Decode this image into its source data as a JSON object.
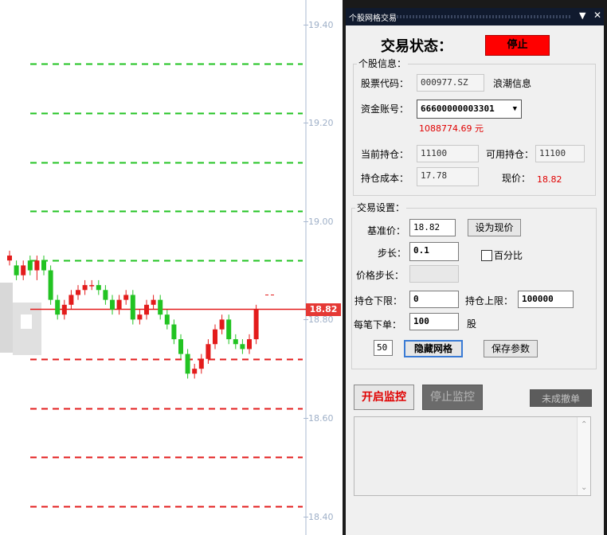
{
  "chart": {
    "price_axis_ticks": [
      "19.40",
      "19.20",
      "19.00",
      "18.80",
      "18.60",
      "18.40"
    ],
    "current_price_tag": "18.82",
    "colors": {
      "up": "#e31c1c",
      "down": "#22c322",
      "grid_up": "#22c322",
      "grid_down": "#e31c1c",
      "price_line": "#e31c1c",
      "axis": "#a8b8d0"
    },
    "grid_lines_above": [
      19.32,
      19.22,
      19.12,
      19.02,
      18.92
    ],
    "grid_lines_below": [
      18.72,
      18.62,
      18.52,
      18.42
    ],
    "candles": [
      {
        "o": 18.92,
        "c": 18.93,
        "h": 18.94,
        "l": 18.91
      },
      {
        "o": 18.91,
        "c": 18.89,
        "h": 18.92,
        "l": 18.88
      },
      {
        "o": 18.89,
        "c": 18.91,
        "h": 18.92,
        "l": 18.88
      },
      {
        "o": 18.92,
        "c": 18.9,
        "h": 18.93,
        "l": 18.89
      },
      {
        "o": 18.9,
        "c": 18.92,
        "h": 18.93,
        "l": 18.88
      },
      {
        "o": 18.92,
        "c": 18.9,
        "h": 18.93,
        "l": 18.89
      },
      {
        "o": 18.9,
        "c": 18.84,
        "h": 18.91,
        "l": 18.83
      },
      {
        "o": 18.84,
        "c": 18.81,
        "h": 18.85,
        "l": 18.8
      },
      {
        "o": 18.81,
        "c": 18.83,
        "h": 18.84,
        "l": 18.8
      },
      {
        "o": 18.83,
        "c": 18.85,
        "h": 18.86,
        "l": 18.82
      },
      {
        "o": 18.85,
        "c": 18.86,
        "h": 18.87,
        "l": 18.84
      },
      {
        "o": 18.86,
        "c": 18.87,
        "h": 18.88,
        "l": 18.85
      },
      {
        "o": 18.87,
        "c": 18.87,
        "h": 18.88,
        "l": 18.86
      },
      {
        "o": 18.87,
        "c": 18.86,
        "h": 18.88,
        "l": 18.85
      },
      {
        "o": 18.86,
        "c": 18.84,
        "h": 18.87,
        "l": 18.83
      },
      {
        "o": 18.84,
        "c": 18.82,
        "h": 18.85,
        "l": 18.81
      },
      {
        "o": 18.82,
        "c": 18.84,
        "h": 18.85,
        "l": 18.81
      },
      {
        "o": 18.84,
        "c": 18.85,
        "h": 18.86,
        "l": 18.83
      },
      {
        "o": 18.85,
        "c": 18.8,
        "h": 18.86,
        "l": 18.79
      },
      {
        "o": 18.8,
        "c": 18.81,
        "h": 18.82,
        "l": 18.79
      },
      {
        "o": 18.81,
        "c": 18.83,
        "h": 18.84,
        "l": 18.8
      },
      {
        "o": 18.83,
        "c": 18.84,
        "h": 18.85,
        "l": 18.82
      },
      {
        "o": 18.84,
        "c": 18.81,
        "h": 18.85,
        "l": 18.8
      },
      {
        "o": 18.81,
        "c": 18.79,
        "h": 18.82,
        "l": 18.78
      },
      {
        "o": 18.79,
        "c": 18.76,
        "h": 18.8,
        "l": 18.75
      },
      {
        "o": 18.76,
        "c": 18.73,
        "h": 18.77,
        "l": 18.72
      },
      {
        "o": 18.73,
        "c": 18.69,
        "h": 18.74,
        "l": 18.68
      },
      {
        "o": 18.69,
        "c": 18.7,
        "h": 18.71,
        "l": 18.68
      },
      {
        "o": 18.7,
        "c": 18.72,
        "h": 18.73,
        "l": 18.69
      },
      {
        "o": 18.72,
        "c": 18.75,
        "h": 18.76,
        "l": 18.71
      },
      {
        "o": 18.75,
        "c": 18.78,
        "h": 18.79,
        "l": 18.74
      },
      {
        "o": 18.78,
        "c": 18.8,
        "h": 18.81,
        "l": 18.77
      },
      {
        "o": 18.8,
        "c": 18.76,
        "h": 18.81,
        "l": 18.75
      },
      {
        "o": 18.76,
        "c": 18.75,
        "h": 18.77,
        "l": 18.74
      },
      {
        "o": 18.75,
        "c": 18.74,
        "h": 18.76,
        "l": 18.73
      },
      {
        "o": 18.74,
        "c": 18.76,
        "h": 18.77,
        "l": 18.73
      },
      {
        "o": 18.76,
        "c": 18.82,
        "h": 18.83,
        "l": 18.75
      }
    ]
  },
  "panel": {
    "title": "个股网格交易",
    "dropdown_glyph": "▼",
    "close_glyph": "✕",
    "status_label": "交易状态：",
    "status_value": "停止",
    "stock_info": {
      "group_title": "个股信息：",
      "code_label": "股票代码：",
      "code_value": "000977.SZ",
      "stock_name": "浪潮信息",
      "account_label": "资金账号：",
      "account_value": "66600000003301",
      "balance": "1088774.69 元",
      "holding_label": "当前持仓：",
      "holding_value": "11100",
      "available_label": "可用持仓：",
      "available_value": "11100",
      "cost_label": "持仓成本：",
      "cost_value": "17.78",
      "price_label": "现价：",
      "price_value": "18.82"
    },
    "settings": {
      "group_title": "交易设置：",
      "base_label": "基准价：",
      "base_value": "18.82",
      "set_price_button": "设为现价",
      "step_label": "步长：",
      "step_value": "0.1",
      "percent_label": "百分比",
      "price_step_label": "价格步长：",
      "lower_label": "持仓下限：",
      "lower_value": "0",
      "upper_label": "持仓上限：",
      "upper_value": "100000",
      "order_label": "每笔下单：",
      "order_value": "100",
      "order_unit": "股",
      "grid_count": "50",
      "hide_grid_button": "隐藏网格",
      "save_button": "保存参数"
    },
    "start_button": "开启监控",
    "stop_button": "停止监控",
    "cancel_button": "未成撤单"
  }
}
